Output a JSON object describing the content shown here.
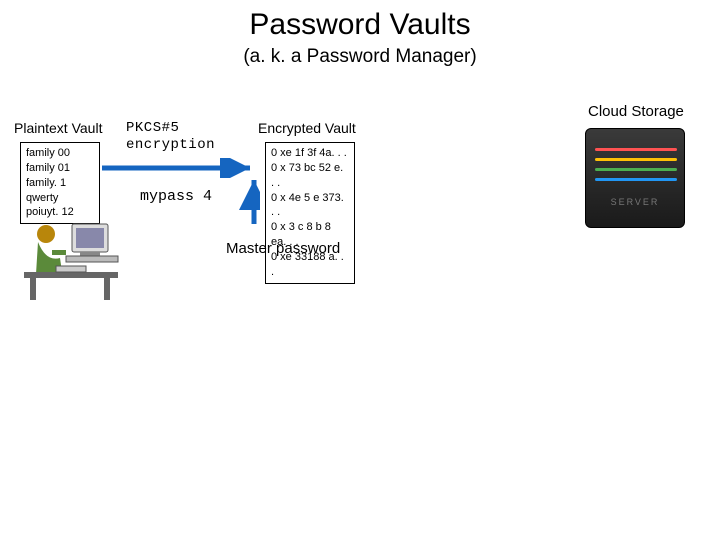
{
  "title": "Password Vaults",
  "subtitle": "(a. k. a Password Manager)",
  "labels": {
    "plaintext": "Plaintext Vault",
    "encrypted": "Encrypted Vault",
    "cloud": "Cloud Storage",
    "master": "Master password"
  },
  "plaintext_items": [
    "family 00",
    "family 01",
    "family. 1",
    "qwerty",
    "poiuyt. 12"
  ],
  "encrypted_items": [
    "0 xe 1f 3f 4a. . .",
    "0 x 73 bc 52 e. . .",
    "0 x 4e 5 e 373. . .",
    "0 x 3 c 8 b 8 ea. . .",
    "0 xe 33188 a. . ."
  ],
  "method": {
    "line1": "PKCS#5",
    "line2": "encryption"
  },
  "master_password": "mypass 4",
  "icons": {
    "user": "user-at-computer-icon",
    "server": "server-rack-icon"
  },
  "colors": {
    "led": [
      "#ff5252",
      "#ffc107",
      "#4caf50",
      "#2196f3"
    ],
    "arrow": "#1565c0"
  }
}
